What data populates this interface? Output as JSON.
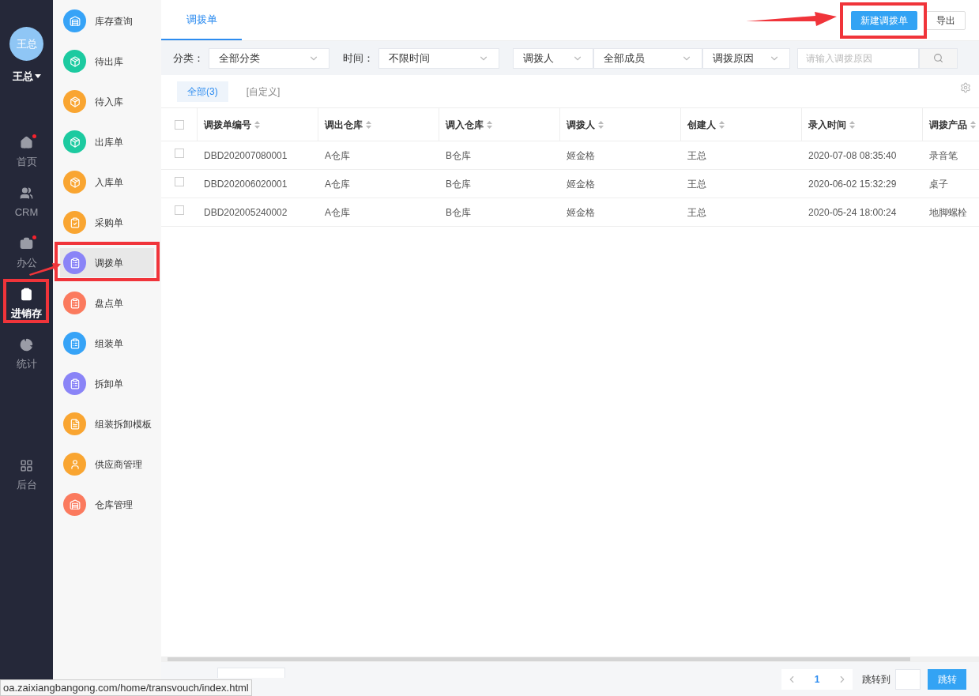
{
  "user": {
    "avatar_text": "王总",
    "name": "王总"
  },
  "nav": [
    {
      "label": "首页",
      "selected": false,
      "badge": true
    },
    {
      "label": "CRM",
      "selected": false,
      "badge": false
    },
    {
      "label": "办公",
      "selected": false,
      "badge": true
    },
    {
      "label": "进销存",
      "selected": true,
      "badge": false
    },
    {
      "label": "统计",
      "selected": false,
      "badge": false
    }
  ],
  "nav_bottom": {
    "label": "后台",
    "selected": false
  },
  "submenu": [
    {
      "label": "库存查询",
      "color": "#36a3f7",
      "selected": false
    },
    {
      "label": "待出库",
      "color": "#1ccaa0",
      "selected": false
    },
    {
      "label": "待入库",
      "color": "#f9a531",
      "selected": false
    },
    {
      "label": "出库单",
      "color": "#1ccaa0",
      "selected": false
    },
    {
      "label": "入库单",
      "color": "#f9a531",
      "selected": false
    },
    {
      "label": "采购单",
      "color": "#f9a531",
      "selected": false
    },
    {
      "label": "调拨单",
      "color": "#8a84f7",
      "selected": true
    },
    {
      "label": "盘点单",
      "color": "#fb7a5e",
      "selected": false
    },
    {
      "label": "组装单",
      "color": "#36a3f7",
      "selected": false
    },
    {
      "label": "拆卸单",
      "color": "#8a84f7",
      "selected": false
    },
    {
      "label": "组装拆卸模板",
      "color": "#f9a531",
      "selected": false
    },
    {
      "label": "供应商管理",
      "color": "#f9a531",
      "selected": false
    },
    {
      "label": "仓库管理",
      "color": "#fb7a5e",
      "selected": false
    }
  ],
  "page_tabs": [
    {
      "label": "调拨单",
      "selected": true
    }
  ],
  "actions": {
    "primary": "新建调拨单",
    "secondary": "导出"
  },
  "filters": {
    "category_label": "分类：",
    "category_value": "全部分类",
    "time_label": "时间：",
    "time_value": "不限时间",
    "person_type": "调拨人",
    "person_value": "全部成员",
    "reason_type": "调拨原因",
    "reason_placeholder": "请输入调拨原因"
  },
  "view_tabs": [
    {
      "label": "全部(3)",
      "selected": true
    },
    {
      "label": "[自定义]",
      "selected": false
    }
  ],
  "table": {
    "all_checked": false,
    "columns": [
      "调拨单编号",
      "调出仓库",
      "调入仓库",
      "调拨人",
      "创建人",
      "录入时间",
      "调拨产品"
    ],
    "rows": [
      {
        "checked": false,
        "cells": [
          "DBD202007080001",
          "A仓库",
          "B仓库",
          "姬金格",
          "王总",
          "2020-07-08 08:35:40",
          "录音笔"
        ]
      },
      {
        "checked": false,
        "cells": [
          "DBD202006020001",
          "A仓库",
          "B仓库",
          "姬金格",
          "王总",
          "2020-06-02 15:32:29",
          "桌子"
        ]
      },
      {
        "checked": false,
        "cells": [
          "DBD202005240002",
          "A仓库",
          "B仓库",
          "姬金格",
          "王总",
          "2020-05-24 18:00:24",
          "地脚螺栓"
        ]
      }
    ]
  },
  "footer": {
    "page": "1",
    "jump_label": "跳转到",
    "jump_button": "跳转"
  },
  "status_url": "oa.zaixiangbangong.com/home/transvouch/index.html"
}
